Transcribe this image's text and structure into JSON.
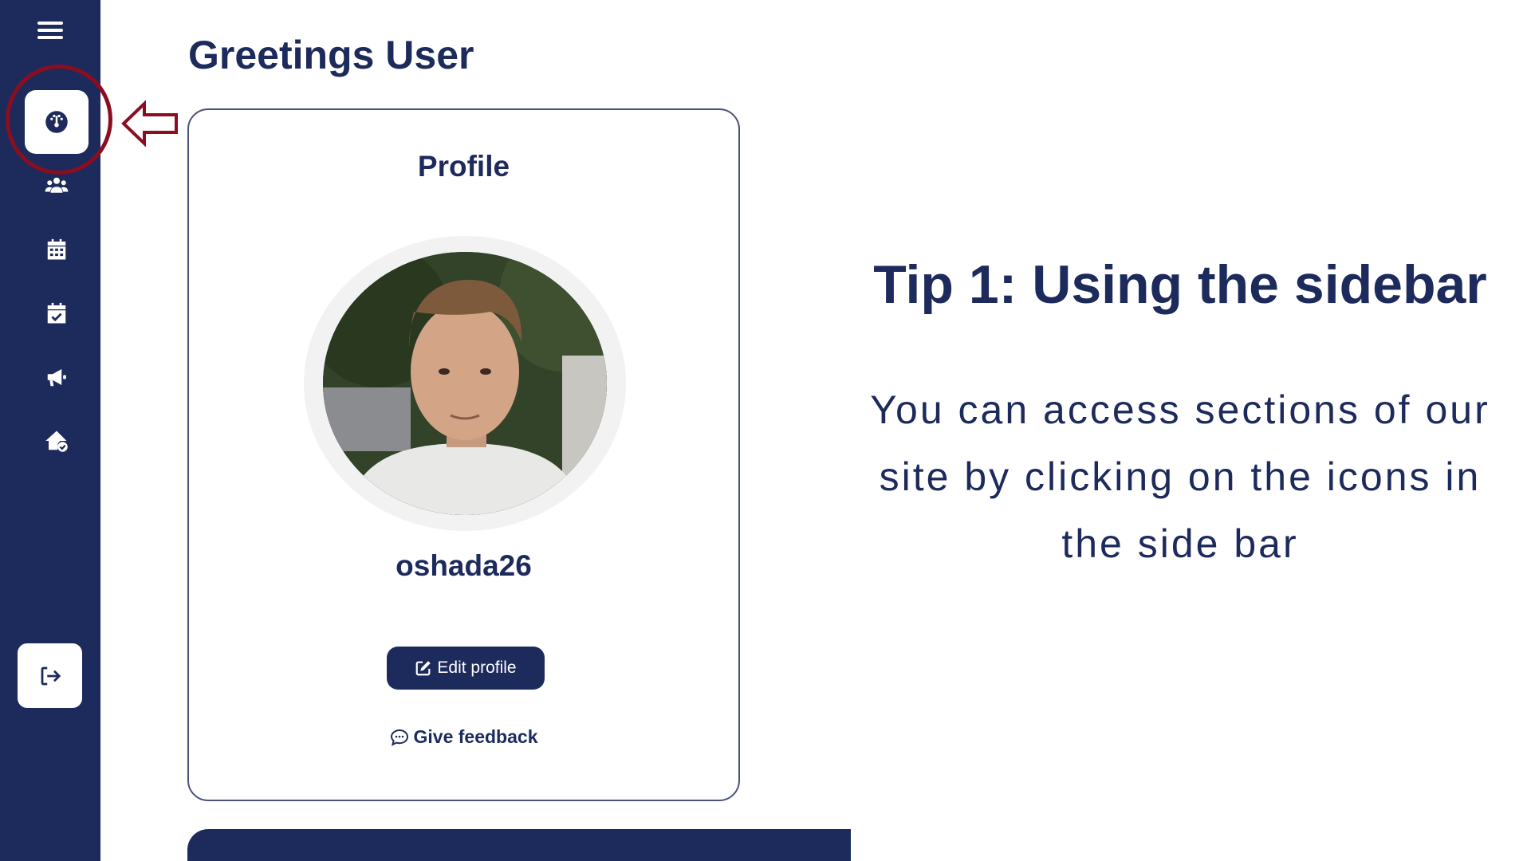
{
  "sidebar": {
    "menu_icon": "hamburger-menu-icon",
    "items": [
      {
        "icon": "dashboard-icon",
        "active": true
      },
      {
        "icon": "users-icon",
        "active": false
      },
      {
        "icon": "calendar-icon",
        "active": false
      },
      {
        "icon": "calendar-check-icon",
        "active": false
      },
      {
        "icon": "megaphone-icon",
        "active": false
      },
      {
        "icon": "house-check-icon",
        "active": false
      }
    ],
    "logout_icon": "logout-icon"
  },
  "header": {
    "greeting": "Greetings User"
  },
  "profile": {
    "title": "Profile",
    "username": "oshada26",
    "edit_label": "Edit profile",
    "feedback_label": "Give feedback"
  },
  "tip": {
    "title": "Tip 1: Using the sidebar",
    "body": "You can access sections of our site by clicking on the icons in the side bar"
  },
  "colors": {
    "navy": "#1d2a5c",
    "highlight": "#8b0e1f",
    "white": "#ffffff"
  }
}
